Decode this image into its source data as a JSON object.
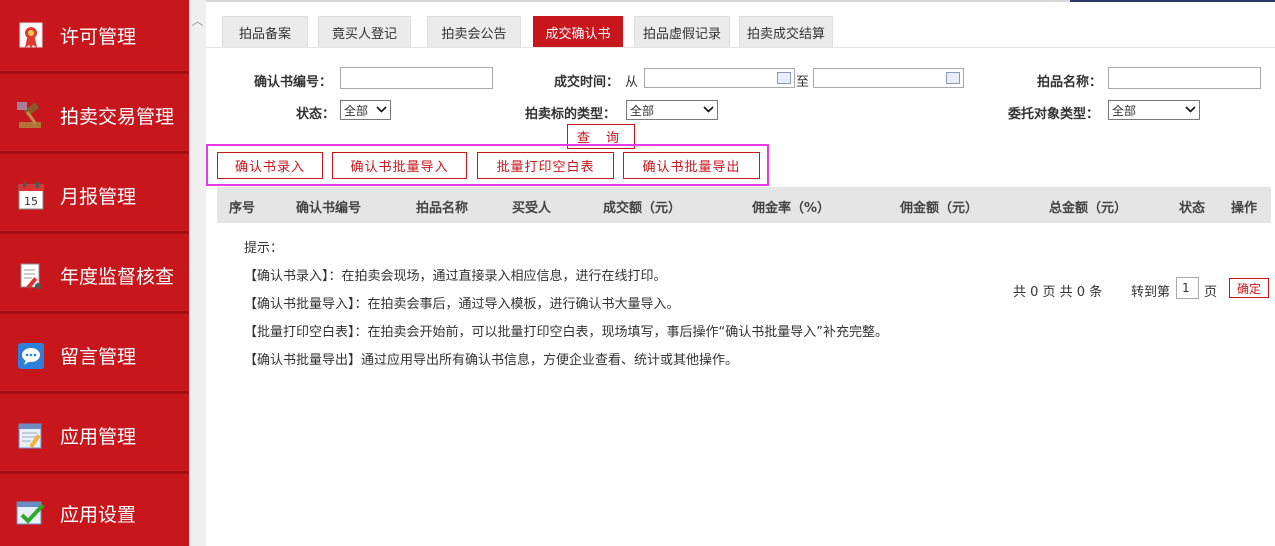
{
  "sidebar": {
    "items": [
      {
        "label": "许可管理"
      },
      {
        "label": "拍卖交易管理"
      },
      {
        "label": "月报管理",
        "calendar_day": "15"
      },
      {
        "label": "年度监督核查"
      },
      {
        "label": "留言管理"
      },
      {
        "label": "应用管理"
      },
      {
        "label": "应用设置"
      }
    ]
  },
  "tabs": [
    {
      "label": "拍品备案"
    },
    {
      "label": "竟买人登记"
    },
    {
      "label": "拍卖会公告"
    },
    {
      "label": "成交确认书",
      "active": true
    },
    {
      "label": "拍品虚假记录"
    },
    {
      "label": "拍卖成交结算"
    }
  ],
  "filters": {
    "cert_no_label": "确认书编号：",
    "deal_time_label": "成交时间：",
    "from_label": "从",
    "to_label": "至",
    "item_name_label": "拍品名称：",
    "status_label": "状态：",
    "status_value": "全部",
    "target_type_label": "拍卖标的类型：",
    "target_type_value": "全部",
    "consign_type_label": "委托对象类型：",
    "consign_type_value": "全部",
    "query_button": "查 询"
  },
  "actions": {
    "entry": "确认书录入",
    "batch_import": "确认书批量导入",
    "batch_print": "批量打印空白表",
    "batch_export": "确认书批量导出"
  },
  "table": {
    "columns": [
      "序号",
      "确认书编号",
      "拍品名称",
      "买受人",
      "成交额（元）",
      "佣金率（%）",
      "佣金额（元）",
      "总金额（元）",
      "状态",
      "操作"
    ]
  },
  "tips": {
    "title": "提示：",
    "lines": [
      "【确认书录入】：在拍卖会现场，通过直接录入相应信息，进行在线打印。",
      "【确认书批量导入】：在拍卖会事后，通过导入模板，进行确认书大量导入。",
      "【批量打印空白表】：在拍卖会开始前，可以批量打印空白表，现场填写，事后操作“确认书批量导入”补充完整。",
      "【确认书批量导出】通过应用导出所有确认书信息，方便企业查看、统计或其他操作。"
    ]
  },
  "pager": {
    "summary": "共 0 页  共 0 条",
    "goto_label": "转到第",
    "page_value": "1",
    "page_unit": "页",
    "confirm": "确定"
  },
  "colors": {
    "brand_red": "#c8161d",
    "highlight_magenta": "#e53ae5",
    "header_gray": "#e5e5e5"
  }
}
